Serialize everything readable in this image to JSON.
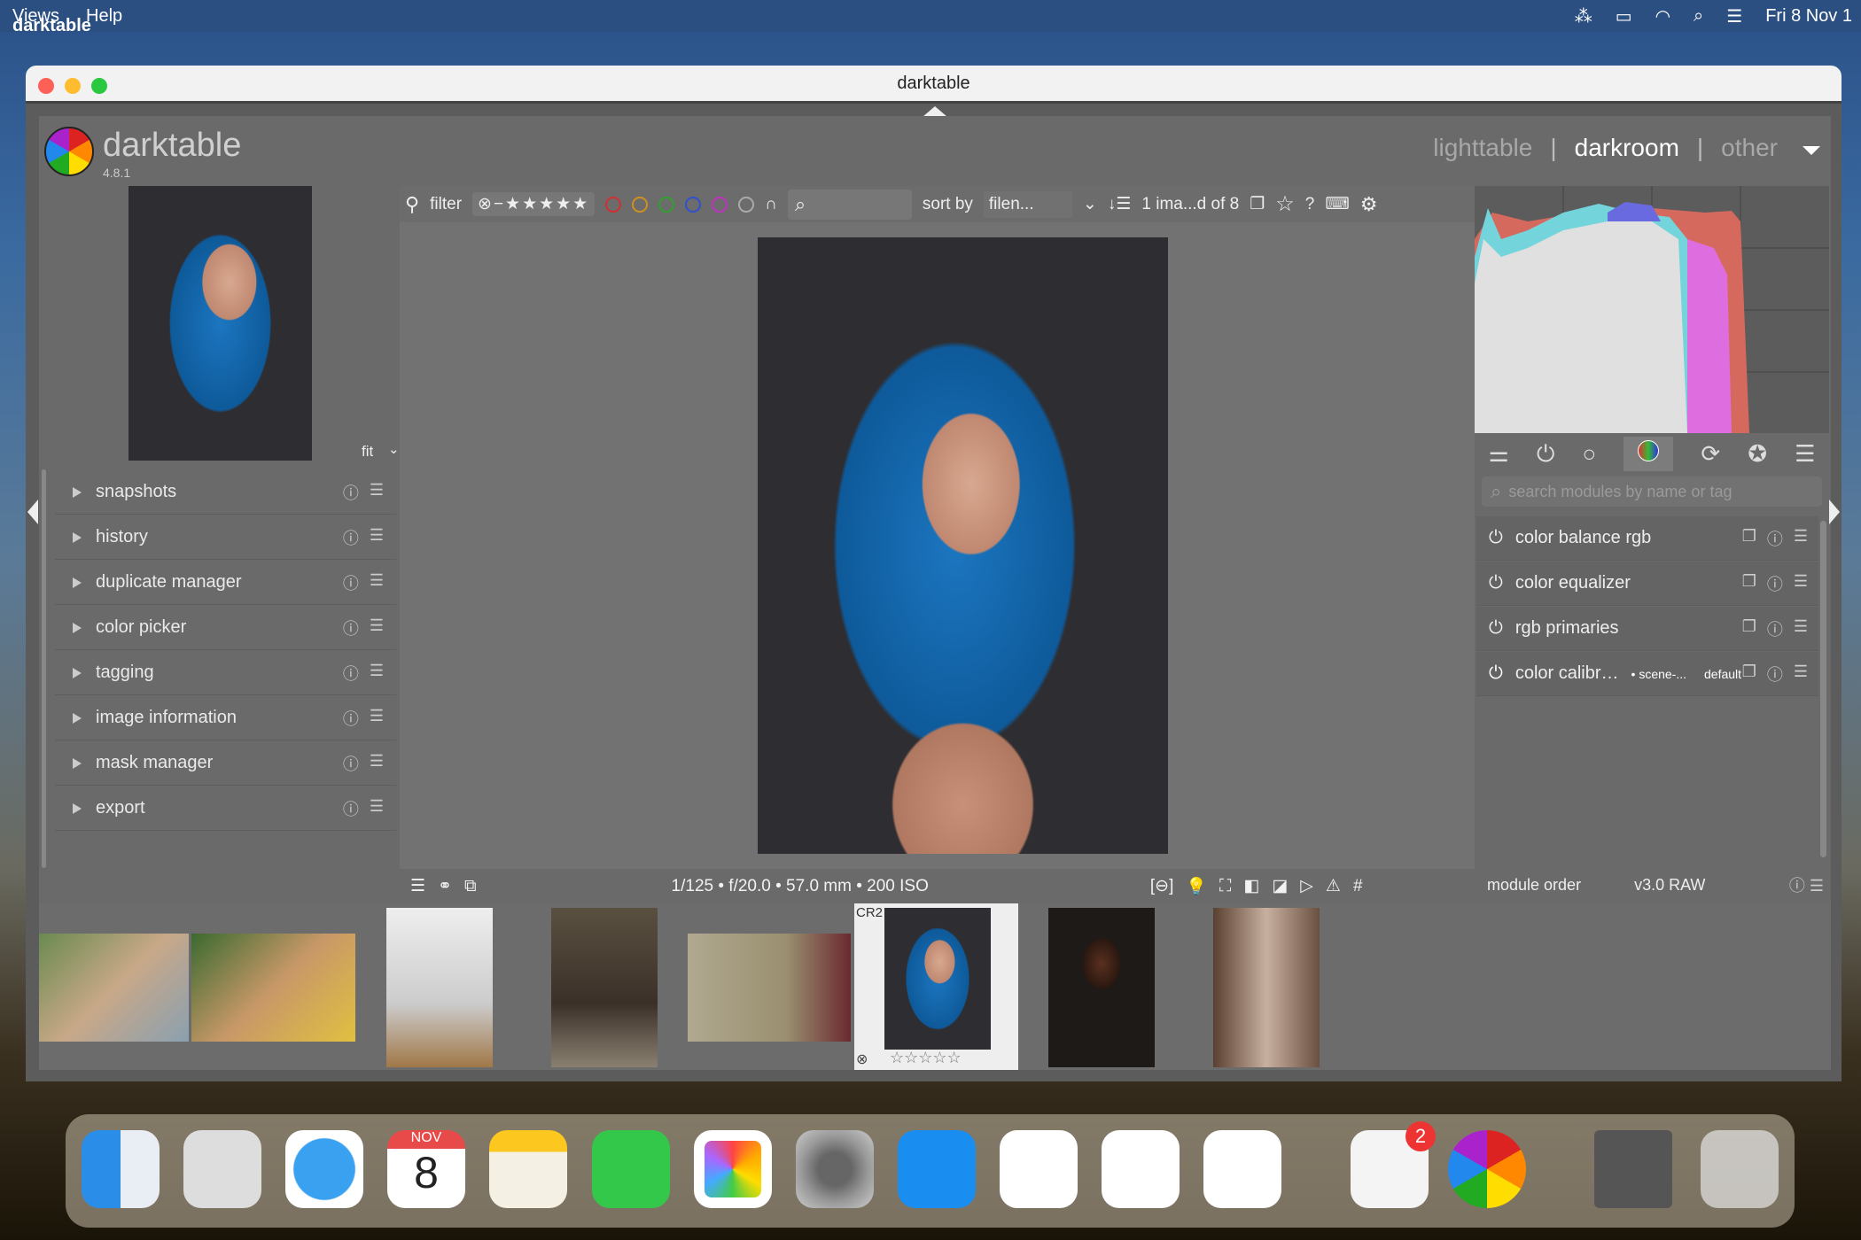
{
  "menubar": {
    "app": "darktable",
    "items": [
      "Views",
      "Help"
    ],
    "clock": "Fri 8 Nov 1"
  },
  "window": {
    "title": "darktable"
  },
  "header": {
    "logo": "darktable",
    "version": "4.8.1",
    "views": [
      "lighttable",
      "darkroom",
      "other"
    ],
    "active_view": "darkroom"
  },
  "left": {
    "zoom": "fit",
    "modules": [
      "snapshots",
      "history",
      "duplicate manager",
      "color picker",
      "tagging",
      "image information",
      "mask manager",
      "export"
    ]
  },
  "toolbar": {
    "filter": "filter",
    "sort_by": "sort by",
    "sort_value": "filen...",
    "count": "1 ima...d of 8",
    "color_labels": [
      "#d03030",
      "#d09020",
      "#30a030",
      "#3050d0",
      "#c030c0",
      "#aaaaaa"
    ]
  },
  "bottom": {
    "exif": "1/125 • f/20.0 • 57.0 mm • 200 ISO"
  },
  "right": {
    "search_placeholder": "search modules by name or tag",
    "modules": [
      {
        "name": "color balance rgb"
      },
      {
        "name": "color equalizer"
      },
      {
        "name": "rgb primaries"
      },
      {
        "name": "color calibr…",
        "preset": "• scene-...",
        "tag": "default"
      }
    ],
    "module_order_label": "module order",
    "module_order_value": "v3.0 RAW"
  },
  "filmstrip": {
    "selected_format": "CR2",
    "selected_index": 5
  },
  "dock": {
    "calendar_month": "NOV",
    "calendar_day": "8",
    "reminders_badge": "2"
  }
}
